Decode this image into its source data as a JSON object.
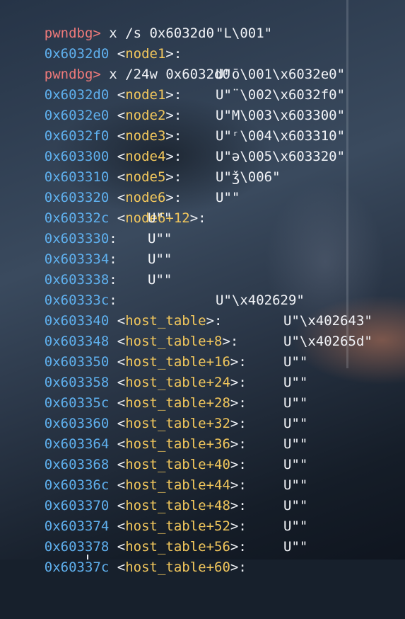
{
  "prompt": "pwndbg>",
  "lines": [
    {
      "type": "cmd",
      "text": "x /s 0x6032d0"
    },
    {
      "type": "mem",
      "addr": "0x6032d0",
      "sym": "node1",
      "val": "\"L\\001\""
    },
    {
      "type": "cmd",
      "text": "x /24w 0x6032d0"
    },
    {
      "type": "mem",
      "addr": "0x6032d0",
      "sym": "node1",
      "val": "U\"ō\\001\\x6032e0\""
    },
    {
      "type": "mem",
      "addr": "0x6032e0",
      "sym": "node2",
      "val": "U\"¨\\002\\x6032f0\""
    },
    {
      "type": "mem",
      "addr": "0x6032f0",
      "sym": "node3",
      "val": "U\"M\\003\\x603300\""
    },
    {
      "type": "mem",
      "addr": "0x603300",
      "sym": "node4",
      "val": "U\"ʳ\\004\\x603310\""
    },
    {
      "type": "mem",
      "addr": "0x603310",
      "sym": "node5",
      "val": "U\"ə\\005\\x603320\""
    },
    {
      "type": "mem",
      "addr": "0x603320",
      "sym": "node6",
      "val": "U\"ǯ\\006\""
    },
    {
      "type": "mem",
      "addr": "0x60332c",
      "sym": "node6+12",
      "val": "U\"\""
    },
    {
      "type": "mem",
      "addr": "0x603330",
      "sym": "",
      "val": "U\"\""
    },
    {
      "type": "mem",
      "addr": "0x603334",
      "sym": "",
      "val": "U\"\""
    },
    {
      "type": "mem",
      "addr": "0x603338",
      "sym": "",
      "val": "U\"\""
    },
    {
      "type": "mem",
      "addr": "0x60333c",
      "sym": "",
      "val": "U\"\""
    },
    {
      "type": "mem",
      "addr": "0x603340",
      "sym": "host_table",
      "val": "U\"\\x402629\""
    },
    {
      "type": "mem",
      "addr": "0x603348",
      "sym": "host_table+8",
      "val": "U\"\\x402643\""
    },
    {
      "type": "mem",
      "addr": "0x603350",
      "sym": "host_table+16",
      "val": "U\"\\x40265d\""
    },
    {
      "type": "mem",
      "addr": "0x603358",
      "sym": "host_table+24",
      "val": "U\"\""
    },
    {
      "type": "mem",
      "addr": "0x60335c",
      "sym": "host_table+28",
      "val": "U\"\""
    },
    {
      "type": "mem",
      "addr": "0x603360",
      "sym": "host_table+32",
      "val": "U\"\""
    },
    {
      "type": "mem",
      "addr": "0x603364",
      "sym": "host_table+36",
      "val": "U\"\""
    },
    {
      "type": "mem",
      "addr": "0x603368",
      "sym": "host_table+40",
      "val": "U\"\""
    },
    {
      "type": "mem",
      "addr": "0x60336c",
      "sym": "host_table+44",
      "val": "U\"\""
    },
    {
      "type": "mem",
      "addr": "0x603370",
      "sym": "host_table+48",
      "val": "U\"\""
    },
    {
      "type": "mem",
      "addr": "0x603374",
      "sym": "host_table+52",
      "val": "U\"\""
    },
    {
      "type": "mem",
      "addr": "0x603378",
      "sym": "host_table+56",
      "val": "U\"\""
    },
    {
      "type": "mem",
      "addr": "0x60337c",
      "sym": "host_table+60",
      "val": "U\"\""
    }
  ],
  "colors": {
    "prompt": "#f07a7a",
    "address": "#5fb0ee",
    "symbol": "#f2c75c",
    "text": "#f2f4f8"
  }
}
